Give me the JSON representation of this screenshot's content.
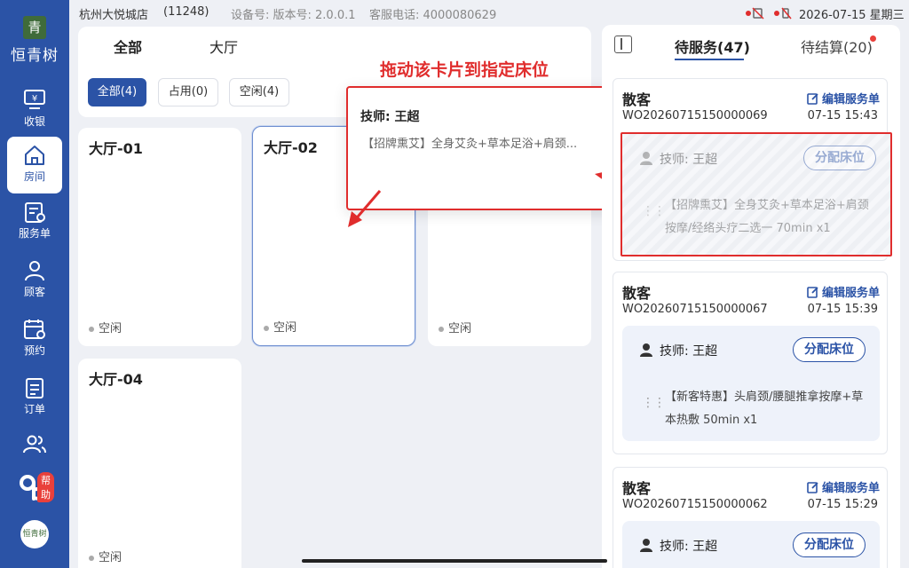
{
  "status_bar": {
    "store_name": "杭州大悦城店",
    "store_code": "(11248)",
    "device_label": "设备号: 版本号: 2.0.0.1",
    "hotline": "客服电话: 4000080629",
    "datetime": "2026-07-15 星期三"
  },
  "sidebar": {
    "logo_mark": "青",
    "brand": "恒青树",
    "items": [
      {
        "label": "收银",
        "icon": "cashier-icon"
      },
      {
        "label": "房间",
        "icon": "home-icon"
      },
      {
        "label": "服务单",
        "icon": "service-order-icon"
      },
      {
        "label": "顾客",
        "icon": "user-icon"
      },
      {
        "label": "预约",
        "icon": "calendar-icon"
      },
      {
        "label": "订单",
        "icon": "order-icon"
      },
      {
        "label": "",
        "icon": "team-icon"
      }
    ],
    "help_badge": "帮助",
    "avatar_text": "恒青树"
  },
  "room_panel": {
    "tabs": [
      "全部",
      "大厅"
    ],
    "filters": [
      "全部(4)",
      "占用(0)",
      "空闲(4)"
    ],
    "hint": "拖动该卡片到指定床位",
    "rooms": [
      {
        "name": "大厅-01",
        "status": "空闲"
      },
      {
        "name": "大厅-02",
        "status": "空闲"
      },
      {
        "name": "",
        "status": "空闲"
      },
      {
        "name": "大厅-04",
        "status": "空闲"
      }
    ]
  },
  "drag_card": {
    "technician": "技师: 王超",
    "service": "【招牌熏艾】全身艾灸+草本足浴+肩颈..."
  },
  "service_panel": {
    "tab_pending": "待服务(47)",
    "tab_settle": "待结算(20)",
    "edit_label": "编辑服务单",
    "assign_label": "分配床位",
    "orders": [
      {
        "customer": "散客",
        "order_no": "WO20260715150000069",
        "time": "07-15 15:43",
        "technician": "技师: 王超",
        "service": "【招牌熏艾】全身艾灸+草本足浴+肩颈按摩/经络头疗二选一 70min x1"
      },
      {
        "customer": "散客",
        "order_no": "WO20260715150000067",
        "time": "07-15 15:39",
        "technician": "技师: 王超",
        "service": "【新客特惠】头肩颈/腰腿推拿按摩+草本热敷 50min x1"
      },
      {
        "customer": "散客",
        "order_no": "WO20260715150000062",
        "time": "07-15 15:29",
        "technician": "技师: 王超",
        "service": ""
      }
    ]
  },
  "colors": {
    "brand": "#2b53a6",
    "annotation": "#e02d2d",
    "badge": "#e9403b"
  }
}
